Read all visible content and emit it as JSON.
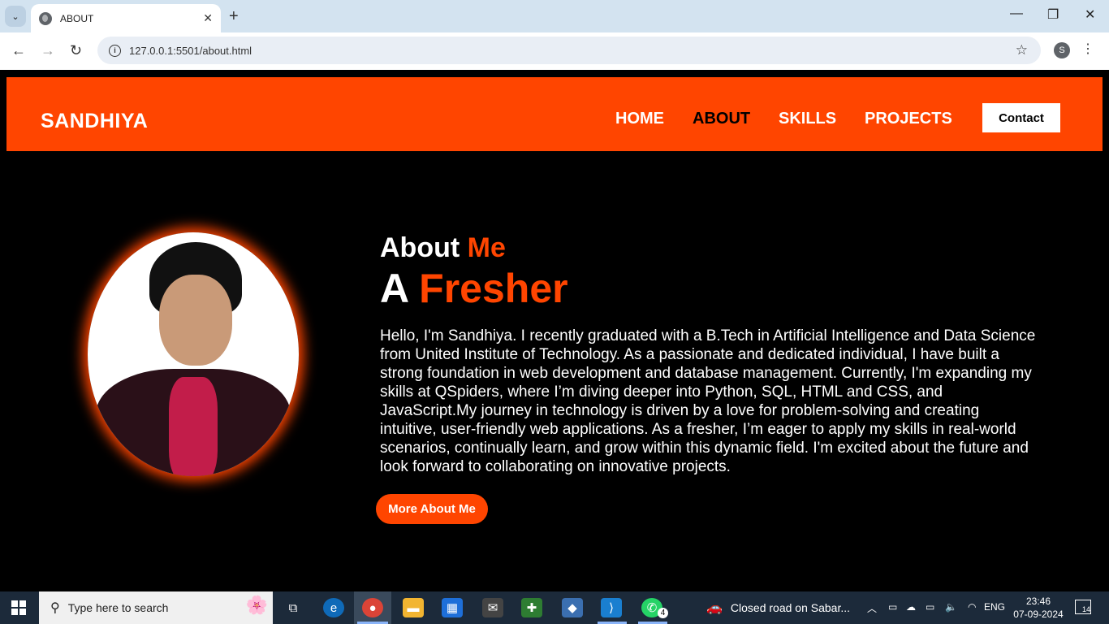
{
  "browser": {
    "tab_title": "ABOUT",
    "url": "127.0.0.1:5501/about.html",
    "profile_initial": "S"
  },
  "site": {
    "logo": "SANDHIYA",
    "nav": [
      "HOME",
      "ABOUT",
      "SKILLS",
      "PROJECTS"
    ],
    "active_nav": "ABOUT",
    "contact_label": "Contact",
    "accent_color": "#ff4500"
  },
  "about": {
    "heading_prefix": "About ",
    "heading_accent": "Me",
    "subheading_prefix": "A ",
    "subheading_accent": "Fresher",
    "paragraph": "Hello, I'm Sandhiya. I recently graduated with a B.Tech in Artificial Intelligence and Data Science from United Institute of Technology. As a passionate and dedicated individual, I have built a strong foundation in web development and database management. Currently, I'm expanding my skills at QSpiders, where I’m diving deeper into Python, SQL, HTML and CSS, and JavaScript.My journey in technology is driven by a love for problem-solving and creating intuitive, user-friendly web applications. As a fresher, I’m eager to apply my skills in real-world scenarios, continually learn, and grow within this dynamic field. I'm excited about the future and look forward to collaborating on innovative projects.",
    "button_label": "More About Me"
  },
  "taskbar": {
    "search_placeholder": "Type here to search",
    "news": "Closed road on Sabar...",
    "language": "ENG",
    "time": "23:46",
    "date": "07-09-2024",
    "whatsapp_badge": "4",
    "notification_count": "14"
  }
}
